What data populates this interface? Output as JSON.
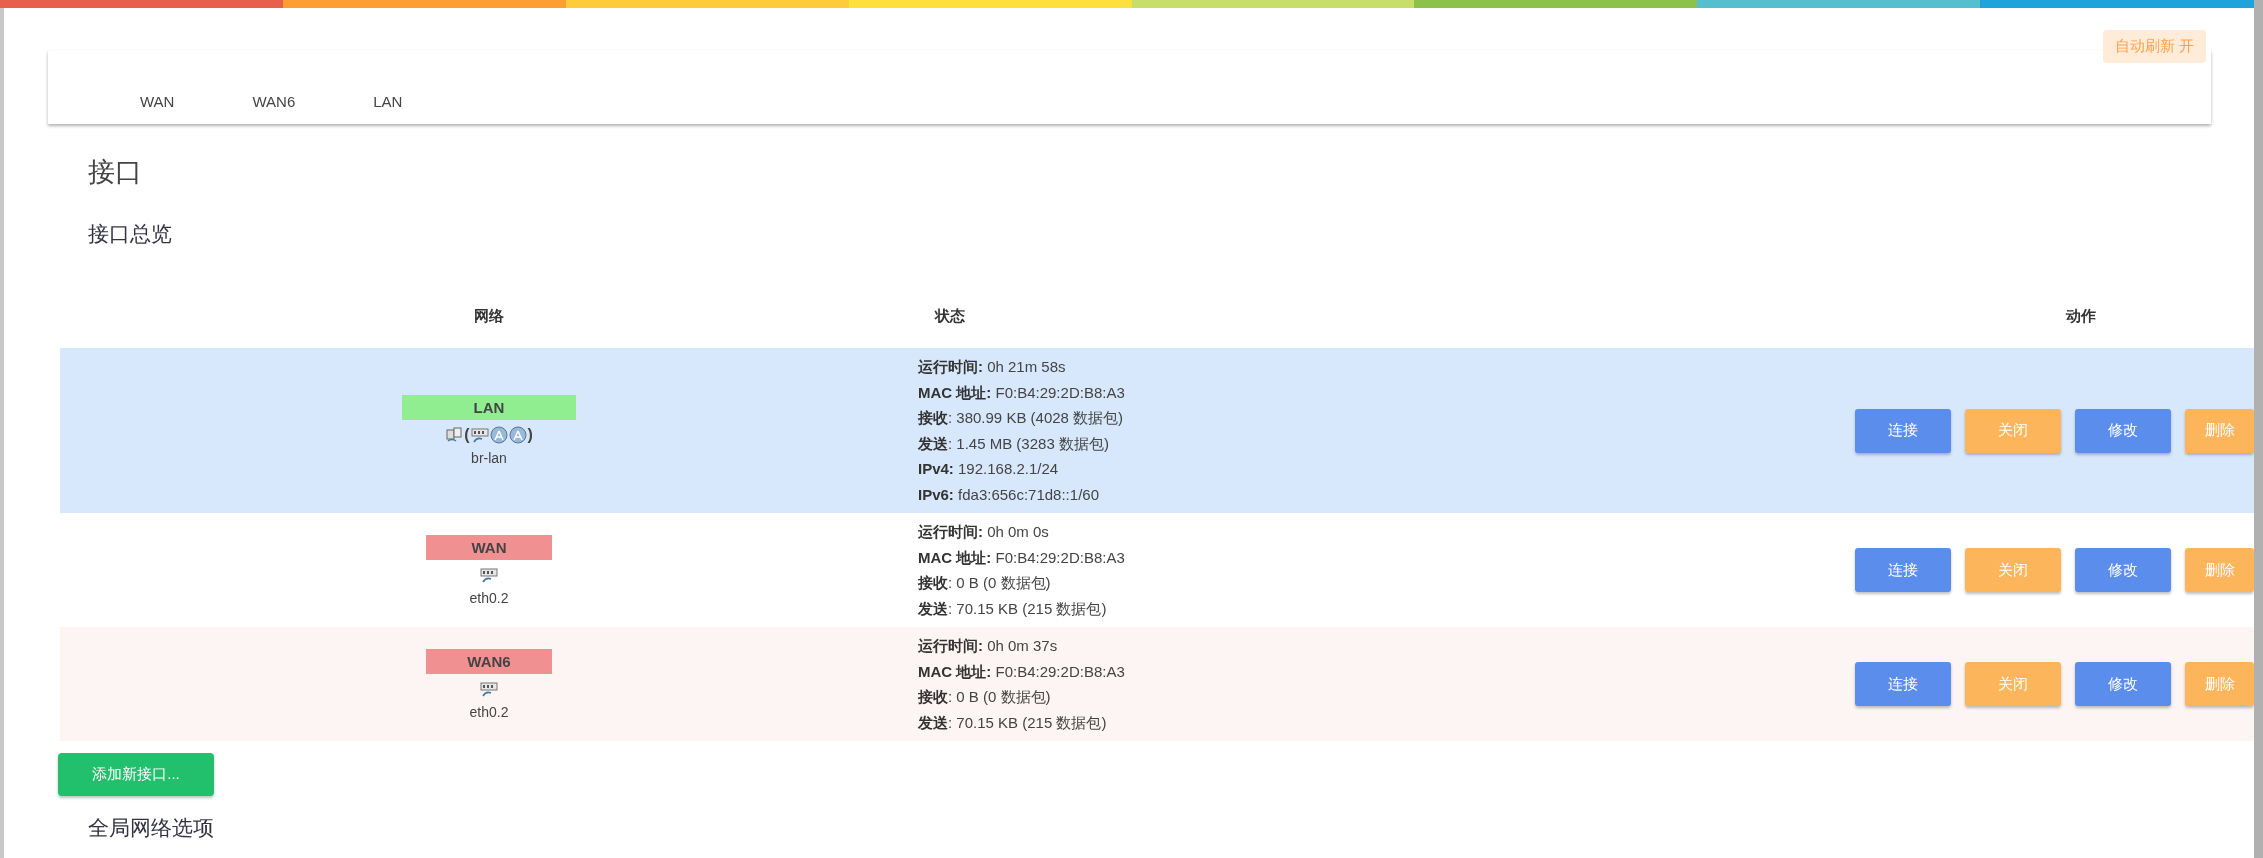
{
  "auto_refresh": {
    "label": "自动刷新 开"
  },
  "tabs": [
    {
      "label": "WAN"
    },
    {
      "label": "WAN6"
    },
    {
      "label": "LAN"
    }
  ],
  "title": "接口",
  "section_title": "接口总览",
  "table": {
    "columns": [
      "网络",
      "状态",
      "动作"
    ],
    "rows": [
      {
        "name": "LAN",
        "color": "#90ee90",
        "highlighted": true,
        "device": "br-lan",
        "icons": [
          {
            "kind": "bridge"
          },
          {
            "kind": "text",
            "text": "("
          },
          {
            "kind": "ethernet"
          },
          {
            "kind": "wifi"
          },
          {
            "kind": "wifi"
          },
          {
            "kind": "text",
            "text": ")"
          }
        ],
        "status": [
          "**运行时间:** 0h 21m 58s",
          "**MAC 地址:** F0:B4:29:2D:B8:A3",
          "**接收**: 380.99 KB (4028 数据包)",
          "**发送**: 1.45 MB (3283 数据包)",
          "**IPv4:** 192.168.2.1/24",
          "**IPv6:** fda3:656c:71d8::1/60"
        ],
        "actions": [
          {
            "label": "连接",
            "kind": "primary"
          },
          {
            "label": "关闭",
            "kind": "warning"
          },
          {
            "label": "修改",
            "kind": "primary"
          },
          {
            "label": "删除",
            "kind": "warning"
          }
        ]
      },
      {
        "name": "WAN",
        "color": "#f09090",
        "highlighted": false,
        "device": "eth0.2",
        "icons": [
          {
            "kind": "ethernet"
          }
        ],
        "status": [
          "**运行时间:** 0h 0m 0s",
          "**MAC 地址:** F0:B4:29:2D:B8:A3",
          "**接收**: 0 B (0 数据包)",
          "**发送**: 70.15 KB (215 数据包)"
        ],
        "actions": [
          {
            "label": "连接",
            "kind": "primary"
          },
          {
            "label": "关闭",
            "kind": "warning"
          },
          {
            "label": "修改",
            "kind": "primary"
          },
          {
            "label": "删除",
            "kind": "warning"
          }
        ]
      },
      {
        "name": "WAN6",
        "color": "#f09090",
        "highlighted": false,
        "device": "eth0.2",
        "icons": [
          {
            "kind": "ethernet"
          }
        ],
        "status": [
          "**运行时间:** 0h 0m 37s",
          "**MAC 地址:** F0:B4:29:2D:B8:A3",
          "**接收**: 0 B (0 数据包)",
          "**发送**: 70.15 KB (215 数据包)"
        ],
        "actions": [
          {
            "label": "连接",
            "kind": "primary"
          },
          {
            "label": "关闭",
            "kind": "warning"
          },
          {
            "label": "修改",
            "kind": "primary"
          },
          {
            "label": "删除",
            "kind": "warning"
          }
        ]
      }
    ]
  },
  "add_button": {
    "label": "添加新接口..."
  },
  "global_title": "全局网络选项"
}
